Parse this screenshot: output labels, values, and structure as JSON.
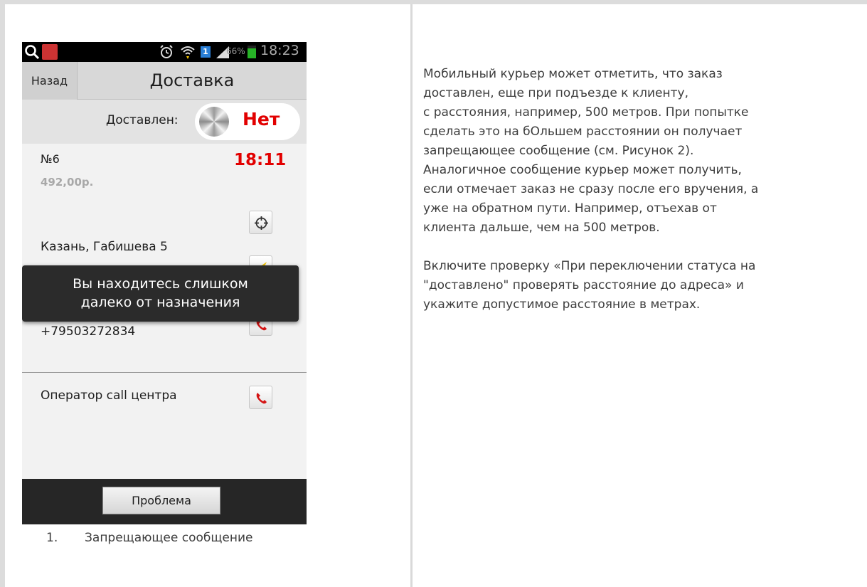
{
  "statusbar": {
    "battery_pct": "66%",
    "time": "18:23",
    "sim_badge": "1",
    "icons": [
      "search-icon",
      "app-icon",
      "alarm-icon",
      "wifi-icon",
      "sim-icon",
      "signal-icon",
      "battery-icon"
    ]
  },
  "titlebar": {
    "back_label": "Назад",
    "title": "Доставка"
  },
  "delivered": {
    "label": "Доставлен:",
    "state": "Нет"
  },
  "order": {
    "number": "№6",
    "time": "18:11",
    "sum": "492,00р.",
    "address": "Казань, Габишева 5",
    "phone": "+79503272834"
  },
  "operator": {
    "label": "Оператор call центра"
  },
  "toast": {
    "line1": "Вы находитесь слишком",
    "line2": "далеко от назначения"
  },
  "bottombar": {
    "problem_label": "Проблема"
  },
  "caption": {
    "number": "1.",
    "text": "Запрещающее сообщение"
  },
  "description": {
    "paragraph1_lines": [
      "Мобильный курьер может отметить, что заказ",
      "доставлен, еще при подъезде к клиенту,",
      "с расстояния, например, 500 метров. При попытке",
      "сделать это на бОльшем расстоянии он получает",
      "запрещающее сообщение (см. Рисунок 2).",
      "Аналогичное сообщение курьер может получить,",
      "если отмечает заказ не сразу после его вручения, а",
      "уже на обратном пути. Например, отъехав от",
      "клиента дальше, чем на 500 метров."
    ],
    "paragraph2_lines": [
      "Включите проверку «При переключении статуса на",
      "\"доставлено\" проверять расстояние до адреса» и",
      "укажите допустимое расстояние в метрах."
    ]
  },
  "colors": {
    "accent_red": "#e20000",
    "toast_bg": "#2b2b2b",
    "bottombar_bg": "#262626"
  }
}
